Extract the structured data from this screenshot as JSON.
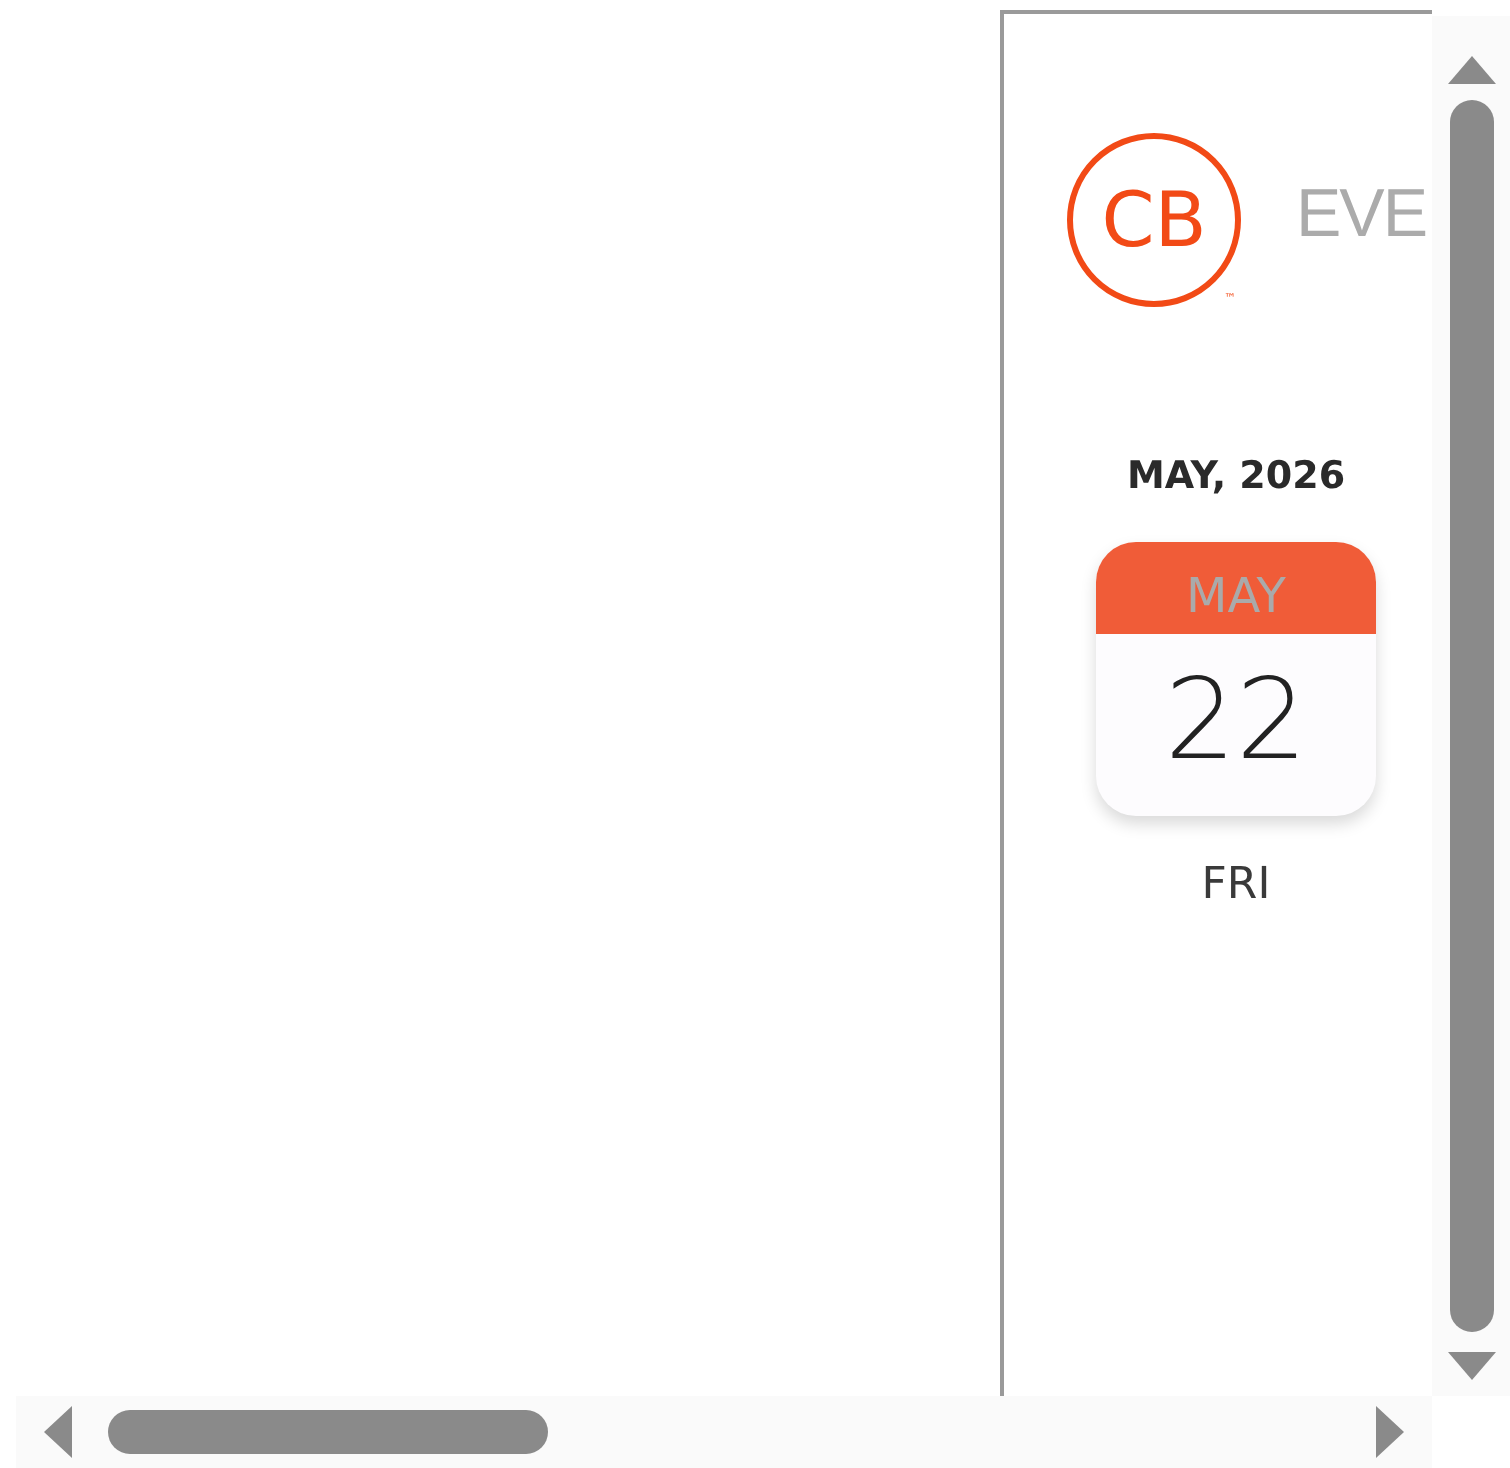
{
  "logo": {
    "initials": "CB",
    "trademark": "™",
    "wordmark": "EVE"
  },
  "month_heading": "MAY, 2026",
  "date_card": {
    "month": "MAY",
    "day": "22",
    "weekday": "FRI"
  }
}
